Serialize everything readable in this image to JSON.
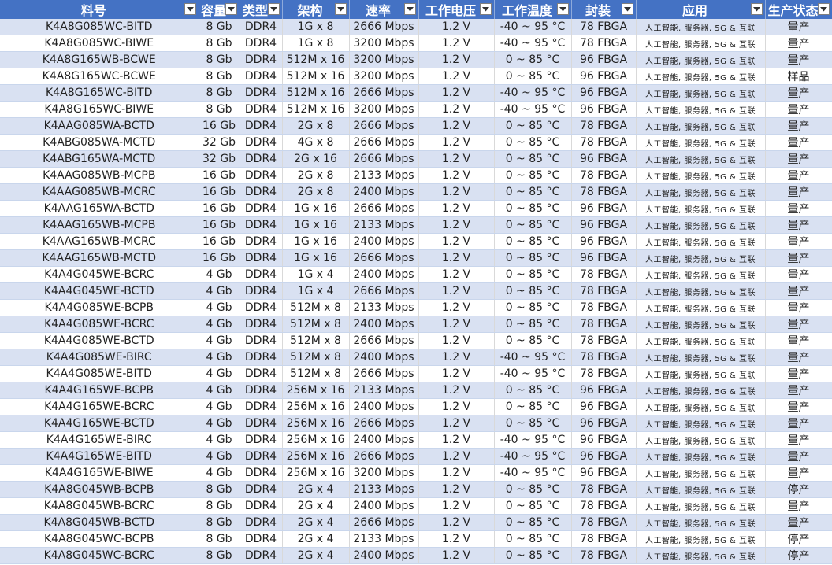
{
  "sheet": {
    "headers": [
      "料号",
      "容量",
      "类型",
      "架构",
      "速率",
      "工作电压",
      "工作温度",
      "封装",
      "应用",
      "生产状态"
    ],
    "filter_icon": "dropdown-arrow-icon",
    "colors": {
      "header_bg": "#4472c4",
      "band_row": "#d9e1f2",
      "plain_row": "#ffffff"
    },
    "rows": [
      [
        "K4A8G085WC-BITD",
        "8 Gb",
        "DDR4",
        "1G x 8",
        "2666 Mbps",
        "1.2 V",
        "-40 ~ 95 °C",
        "78 FBGA",
        "人工智能, 服务器, 5G & 互联",
        "量产"
      ],
      [
        "K4A8G085WC-BIWE",
        "8 Gb",
        "DDR4",
        "1G x 8",
        "3200 Mbps",
        "1.2 V",
        "-40 ~ 95 °C",
        "78 FBGA",
        "人工智能, 服务器, 5G & 互联",
        "量产"
      ],
      [
        "K4A8G165WB-BCWE",
        "8 Gb",
        "DDR4",
        "512M x 16",
        "3200 Mbps",
        "1.2 V",
        "0 ~ 85 °C",
        "96 FBGA",
        "人工智能, 服务器, 5G & 互联",
        "量产"
      ],
      [
        "K4A8G165WC-BCWE",
        "8 Gb",
        "DDR4",
        "512M x 16",
        "3200 Mbps",
        "1.2 V",
        "0 ~ 85 °C",
        "96 FBGA",
        "人工智能, 服务器, 5G & 互联",
        "样品"
      ],
      [
        "K4A8G165WC-BITD",
        "8 Gb",
        "DDR4",
        "512M x 16",
        "2666 Mbps",
        "1.2 V",
        "-40 ~ 95 °C",
        "96 FBGA",
        "人工智能, 服务器, 5G & 互联",
        "量产"
      ],
      [
        "K4A8G165WC-BIWE",
        "8 Gb",
        "DDR4",
        "512M x 16",
        "3200 Mbps",
        "1.2 V",
        "-40 ~ 95 °C",
        "96 FBGA",
        "人工智能, 服务器, 5G & 互联",
        "量产"
      ],
      [
        "K4AAG085WA-BCTD",
        "16 Gb",
        "DDR4",
        "2G x 8",
        "2666 Mbps",
        "1.2 V",
        "0 ~ 85 °C",
        "78 FBGA",
        "人工智能, 服务器, 5G & 互联",
        "量产"
      ],
      [
        "K4ABG085WA-MCTD",
        "32 Gb",
        "DDR4",
        "4G x 8",
        "2666 Mbps",
        "1.2 V",
        "0 ~ 85 °C",
        "78 FBGA",
        "人工智能, 服务器, 5G & 互联",
        "量产"
      ],
      [
        "K4ABG165WA-MCTD",
        "32 Gb",
        "DDR4",
        "2G x 16",
        "2666 Mbps",
        "1.2 V",
        "0 ~ 85 °C",
        "96 FBGA",
        "人工智能, 服务器, 5G & 互联",
        "量产"
      ],
      [
        "K4AAG085WB-MCPB",
        "16 Gb",
        "DDR4",
        "2G x 8",
        "2133 Mbps",
        "1.2 V",
        "0 ~ 85 °C",
        "78 FBGA",
        "人工智能, 服务器, 5G & 互联",
        "量产"
      ],
      [
        "K4AAG085WB-MCRC",
        "16 Gb",
        "DDR4",
        "2G x 8",
        "2400 Mbps",
        "1.2 V",
        "0 ~ 85 °C",
        "78 FBGA",
        "人工智能, 服务器, 5G & 互联",
        "量产"
      ],
      [
        "K4AAG165WA-BCTD",
        "16 Gb",
        "DDR4",
        "1G x 16",
        "2666 Mbps",
        "1.2 V",
        "0 ~ 85 °C",
        "96 FBGA",
        "人工智能, 服务器, 5G & 互联",
        "量产"
      ],
      [
        "K4AAG165WB-MCPB",
        "16 Gb",
        "DDR4",
        "1G x 16",
        "2133 Mbps",
        "1.2 V",
        "0 ~ 85 °C",
        "96 FBGA",
        "人工智能, 服务器, 5G & 互联",
        "量产"
      ],
      [
        "K4AAG165WB-MCRC",
        "16 Gb",
        "DDR4",
        "1G x 16",
        "2400 Mbps",
        "1.2 V",
        "0 ~ 85 °C",
        "96 FBGA",
        "人工智能, 服务器, 5G & 互联",
        "量产"
      ],
      [
        "K4AAG165WB-MCTD",
        "16 Gb",
        "DDR4",
        "1G x 16",
        "2666 Mbps",
        "1.2 V",
        "0 ~ 85 °C",
        "96 FBGA",
        "人工智能, 服务器, 5G & 互联",
        "量产"
      ],
      [
        "K4A4G045WE-BCRC",
        "4 Gb",
        "DDR4",
        "1G x 4",
        "2400 Mbps",
        "1.2 V",
        "0 ~ 85 °C",
        "78 FBGA",
        "人工智能, 服务器, 5G & 互联",
        "量产"
      ],
      [
        "K4A4G045WE-BCTD",
        "4 Gb",
        "DDR4",
        "1G x 4",
        "2666 Mbps",
        "1.2 V",
        "0 ~ 85 °C",
        "78 FBGA",
        "人工智能, 服务器, 5G & 互联",
        "量产"
      ],
      [
        "K4A4G085WE-BCPB",
        "4 Gb",
        "DDR4",
        "512M x 8",
        "2133 Mbps",
        "1.2 V",
        "0 ~ 85 °C",
        "78 FBGA",
        "人工智能, 服务器, 5G & 互联",
        "量产"
      ],
      [
        "K4A4G085WE-BCRC",
        "4 Gb",
        "DDR4",
        "512M x 8",
        "2400 Mbps",
        "1.2 V",
        "0 ~ 85 °C",
        "78 FBGA",
        "人工智能, 服务器, 5G & 互联",
        "量产"
      ],
      [
        "K4A4G085WE-BCTD",
        "4 Gb",
        "DDR4",
        "512M x 8",
        "2666 Mbps",
        "1.2 V",
        "0 ~ 85 °C",
        "78 FBGA",
        "人工智能, 服务器, 5G & 互联",
        "量产"
      ],
      [
        "K4A4G085WE-BIRC",
        "4 Gb",
        "DDR4",
        "512M x 8",
        "2400 Mbps",
        "1.2 V",
        "-40 ~ 95 °C",
        "78 FBGA",
        "人工智能, 服务器, 5G & 互联",
        "量产"
      ],
      [
        "K4A4G085WE-BITD",
        "4 Gb",
        "DDR4",
        "512M x 8",
        "2666 Mbps",
        "1.2 V",
        "-40 ~ 95 °C",
        "78 FBGA",
        "人工智能, 服务器, 5G & 互联",
        "量产"
      ],
      [
        "K4A4G165WE-BCPB",
        "4 Gb",
        "DDR4",
        "256M x 16",
        "2133 Mbps",
        "1.2 V",
        "0 ~ 85 °C",
        "96 FBGA",
        "人工智能, 服务器, 5G & 互联",
        "量产"
      ],
      [
        "K4A4G165WE-BCRC",
        "4 Gb",
        "DDR4",
        "256M x 16",
        "2400 Mbps",
        "1.2 V",
        "0 ~ 85 °C",
        "96 FBGA",
        "人工智能, 服务器, 5G & 互联",
        "量产"
      ],
      [
        "K4A4G165WE-BCTD",
        "4 Gb",
        "DDR4",
        "256M x 16",
        "2666 Mbps",
        "1.2 V",
        "0 ~ 85 °C",
        "96 FBGA",
        "人工智能, 服务器, 5G & 互联",
        "量产"
      ],
      [
        "K4A4G165WE-BIRC",
        "4 Gb",
        "DDR4",
        "256M x 16",
        "2400 Mbps",
        "1.2 V",
        "-40 ~ 95 °C",
        "96 FBGA",
        "人工智能, 服务器, 5G & 互联",
        "量产"
      ],
      [
        "K4A4G165WE-BITD",
        "4 Gb",
        "DDR4",
        "256M x 16",
        "2666 Mbps",
        "1.2 V",
        "-40 ~ 95 °C",
        "96 FBGA",
        "人工智能, 服务器, 5G & 互联",
        "量产"
      ],
      [
        "K4A4G165WE-BIWE",
        "4 Gb",
        "DDR4",
        "256M x 16",
        "3200 Mbps",
        "1.2 V",
        "-40 ~ 95 °C",
        "96 FBGA",
        "人工智能, 服务器, 5G & 互联",
        "量产"
      ],
      [
        "K4A8G045WB-BCPB",
        "8 Gb",
        "DDR4",
        "2G x 4",
        "2133 Mbps",
        "1.2 V",
        "0 ~ 85 °C",
        "78 FBGA",
        "人工智能, 服务器, 5G & 互联",
        "停产"
      ],
      [
        "K4A8G045WB-BCRC",
        "8 Gb",
        "DDR4",
        "2G x 4",
        "2400 Mbps",
        "1.2 V",
        "0 ~ 85 °C",
        "78 FBGA",
        "人工智能, 服务器, 5G & 互联",
        "量产"
      ],
      [
        "K4A8G045WB-BCTD",
        "8 Gb",
        "DDR4",
        "2G x 4",
        "2666 Mbps",
        "1.2 V",
        "0 ~ 85 °C",
        "78 FBGA",
        "人工智能, 服务器, 5G & 互联",
        "量产"
      ],
      [
        "K4A8G045WC-BCPB",
        "8 Gb",
        "DDR4",
        "2G x 4",
        "2133 Mbps",
        "1.2 V",
        "0 ~ 85 °C",
        "78 FBGA",
        "人工智能, 服务器, 5G & 互联",
        "停产"
      ],
      [
        "K4A8G045WC-BCRC",
        "8 Gb",
        "DDR4",
        "2G x 4",
        "2400 Mbps",
        "1.2 V",
        "0 ~ 85 °C",
        "78 FBGA",
        "人工智能, 服务器, 5G & 互联",
        "停产"
      ]
    ]
  }
}
